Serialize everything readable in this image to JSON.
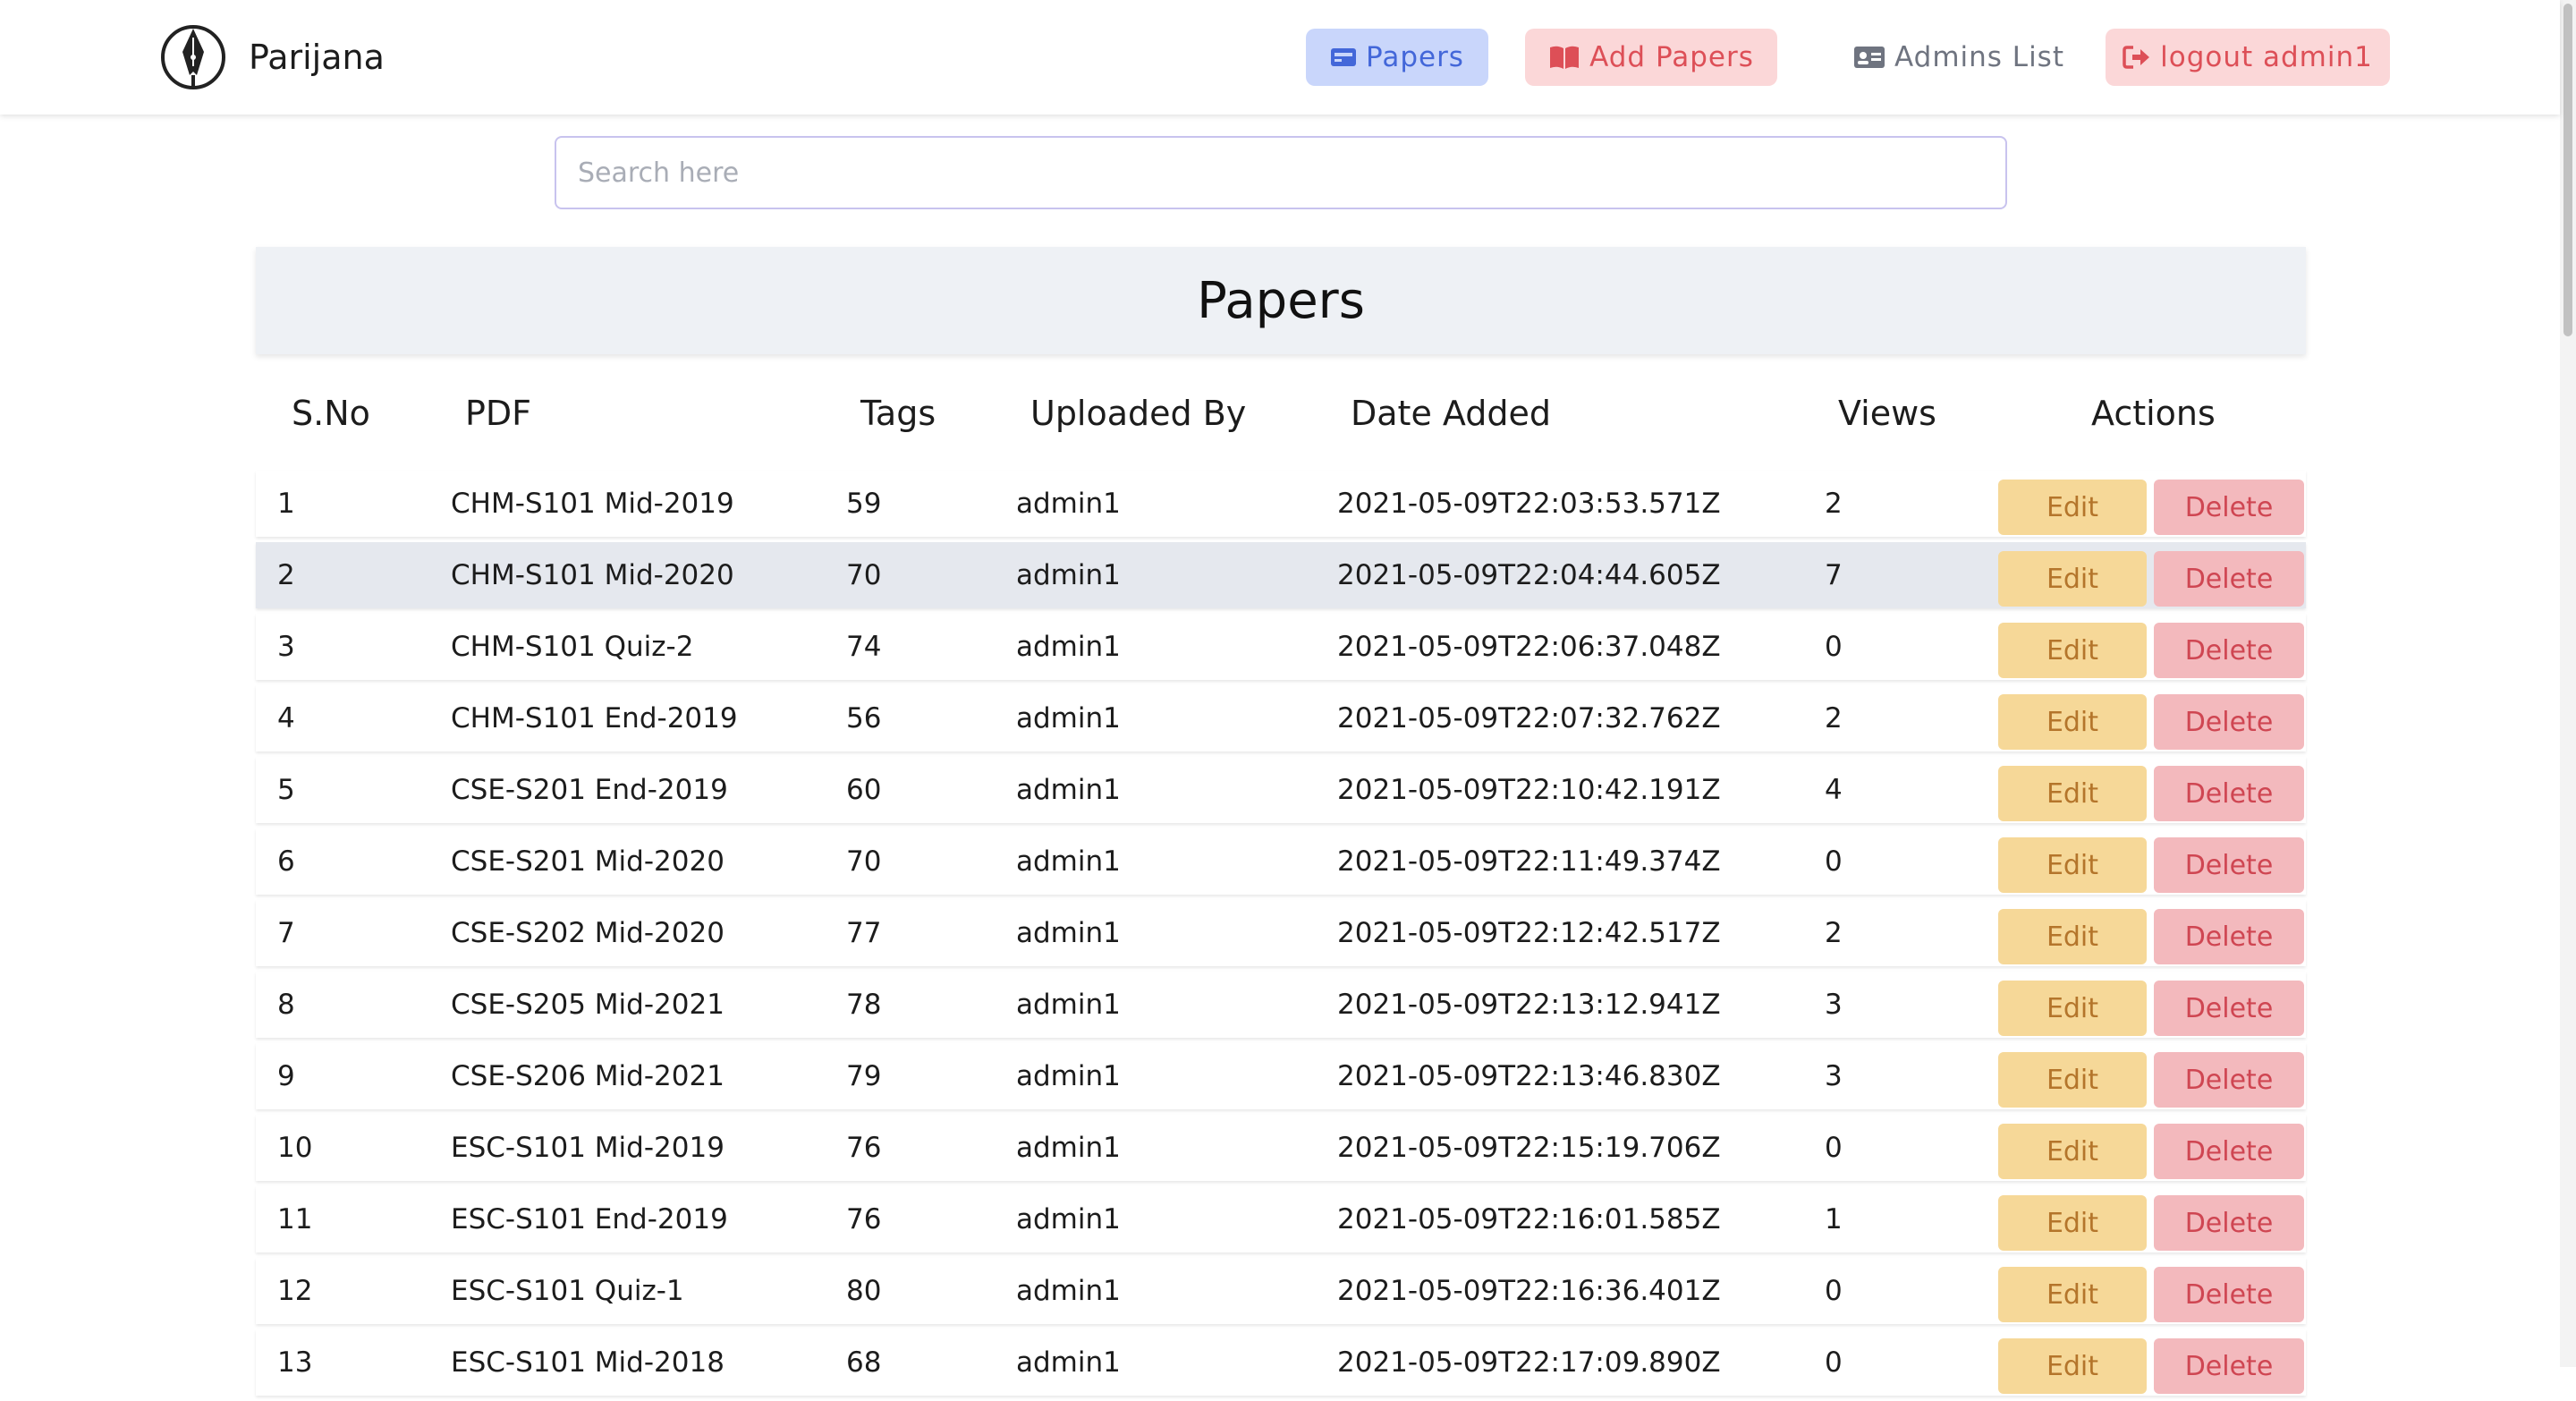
{
  "navbar": {
    "brand": "Parijana",
    "links": {
      "papers": "Papers",
      "add_papers": "Add Papers",
      "admins_list": "Admins List",
      "logout": "logout admin1"
    }
  },
  "search": {
    "placeholder": "Search here"
  },
  "page_title": "Papers",
  "table": {
    "headers": {
      "sno": "S.No",
      "pdf": "PDF",
      "tags": "Tags",
      "uploaded_by": "Uploaded By",
      "date_added": "Date Added",
      "views": "Views",
      "actions": "Actions"
    },
    "edit_label": "Edit",
    "delete_label": "Delete",
    "rows": [
      {
        "sno": "1",
        "pdf": "CHM-S101 Mid-2019",
        "tags": "59",
        "uploaded_by": "admin1",
        "date_added": "2021-05-09T22:03:53.571Z",
        "views": "2"
      },
      {
        "sno": "2",
        "pdf": "CHM-S101 Mid-2020",
        "tags": "70",
        "uploaded_by": "admin1",
        "date_added": "2021-05-09T22:04:44.605Z",
        "views": "7"
      },
      {
        "sno": "3",
        "pdf": "CHM-S101 Quiz-2",
        "tags": "74",
        "uploaded_by": "admin1",
        "date_added": "2021-05-09T22:06:37.048Z",
        "views": "0"
      },
      {
        "sno": "4",
        "pdf": "CHM-S101 End-2019",
        "tags": "56",
        "uploaded_by": "admin1",
        "date_added": "2021-05-09T22:07:32.762Z",
        "views": "2"
      },
      {
        "sno": "5",
        "pdf": "CSE-S201 End-2019",
        "tags": "60",
        "uploaded_by": "admin1",
        "date_added": "2021-05-09T22:10:42.191Z",
        "views": "4"
      },
      {
        "sno": "6",
        "pdf": "CSE-S201 Mid-2020",
        "tags": "70",
        "uploaded_by": "admin1",
        "date_added": "2021-05-09T22:11:49.374Z",
        "views": "0"
      },
      {
        "sno": "7",
        "pdf": "CSE-S202 Mid-2020",
        "tags": "77",
        "uploaded_by": "admin1",
        "date_added": "2021-05-09T22:12:42.517Z",
        "views": "2"
      },
      {
        "sno": "8",
        "pdf": "CSE-S205 Mid-2021",
        "tags": "78",
        "uploaded_by": "admin1",
        "date_added": "2021-05-09T22:13:12.941Z",
        "views": "3"
      },
      {
        "sno": "9",
        "pdf": "CSE-S206 Mid-2021",
        "tags": "79",
        "uploaded_by": "admin1",
        "date_added": "2021-05-09T22:13:46.830Z",
        "views": "3"
      },
      {
        "sno": "10",
        "pdf": "ESC-S101 Mid-2019",
        "tags": "76",
        "uploaded_by": "admin1",
        "date_added": "2021-05-09T22:15:19.706Z",
        "views": "0"
      },
      {
        "sno": "11",
        "pdf": "ESC-S101 End-2019",
        "tags": "76",
        "uploaded_by": "admin1",
        "date_added": "2021-05-09T22:16:01.585Z",
        "views": "1"
      },
      {
        "sno": "12",
        "pdf": "ESC-S101 Quiz-1",
        "tags": "80",
        "uploaded_by": "admin1",
        "date_added": "2021-05-09T22:16:36.401Z",
        "views": "0"
      },
      {
        "sno": "13",
        "pdf": "ESC-S101 Mid-2018",
        "tags": "68",
        "uploaded_by": "admin1",
        "date_added": "2021-05-09T22:17:09.890Z",
        "views": "0"
      }
    ]
  }
}
